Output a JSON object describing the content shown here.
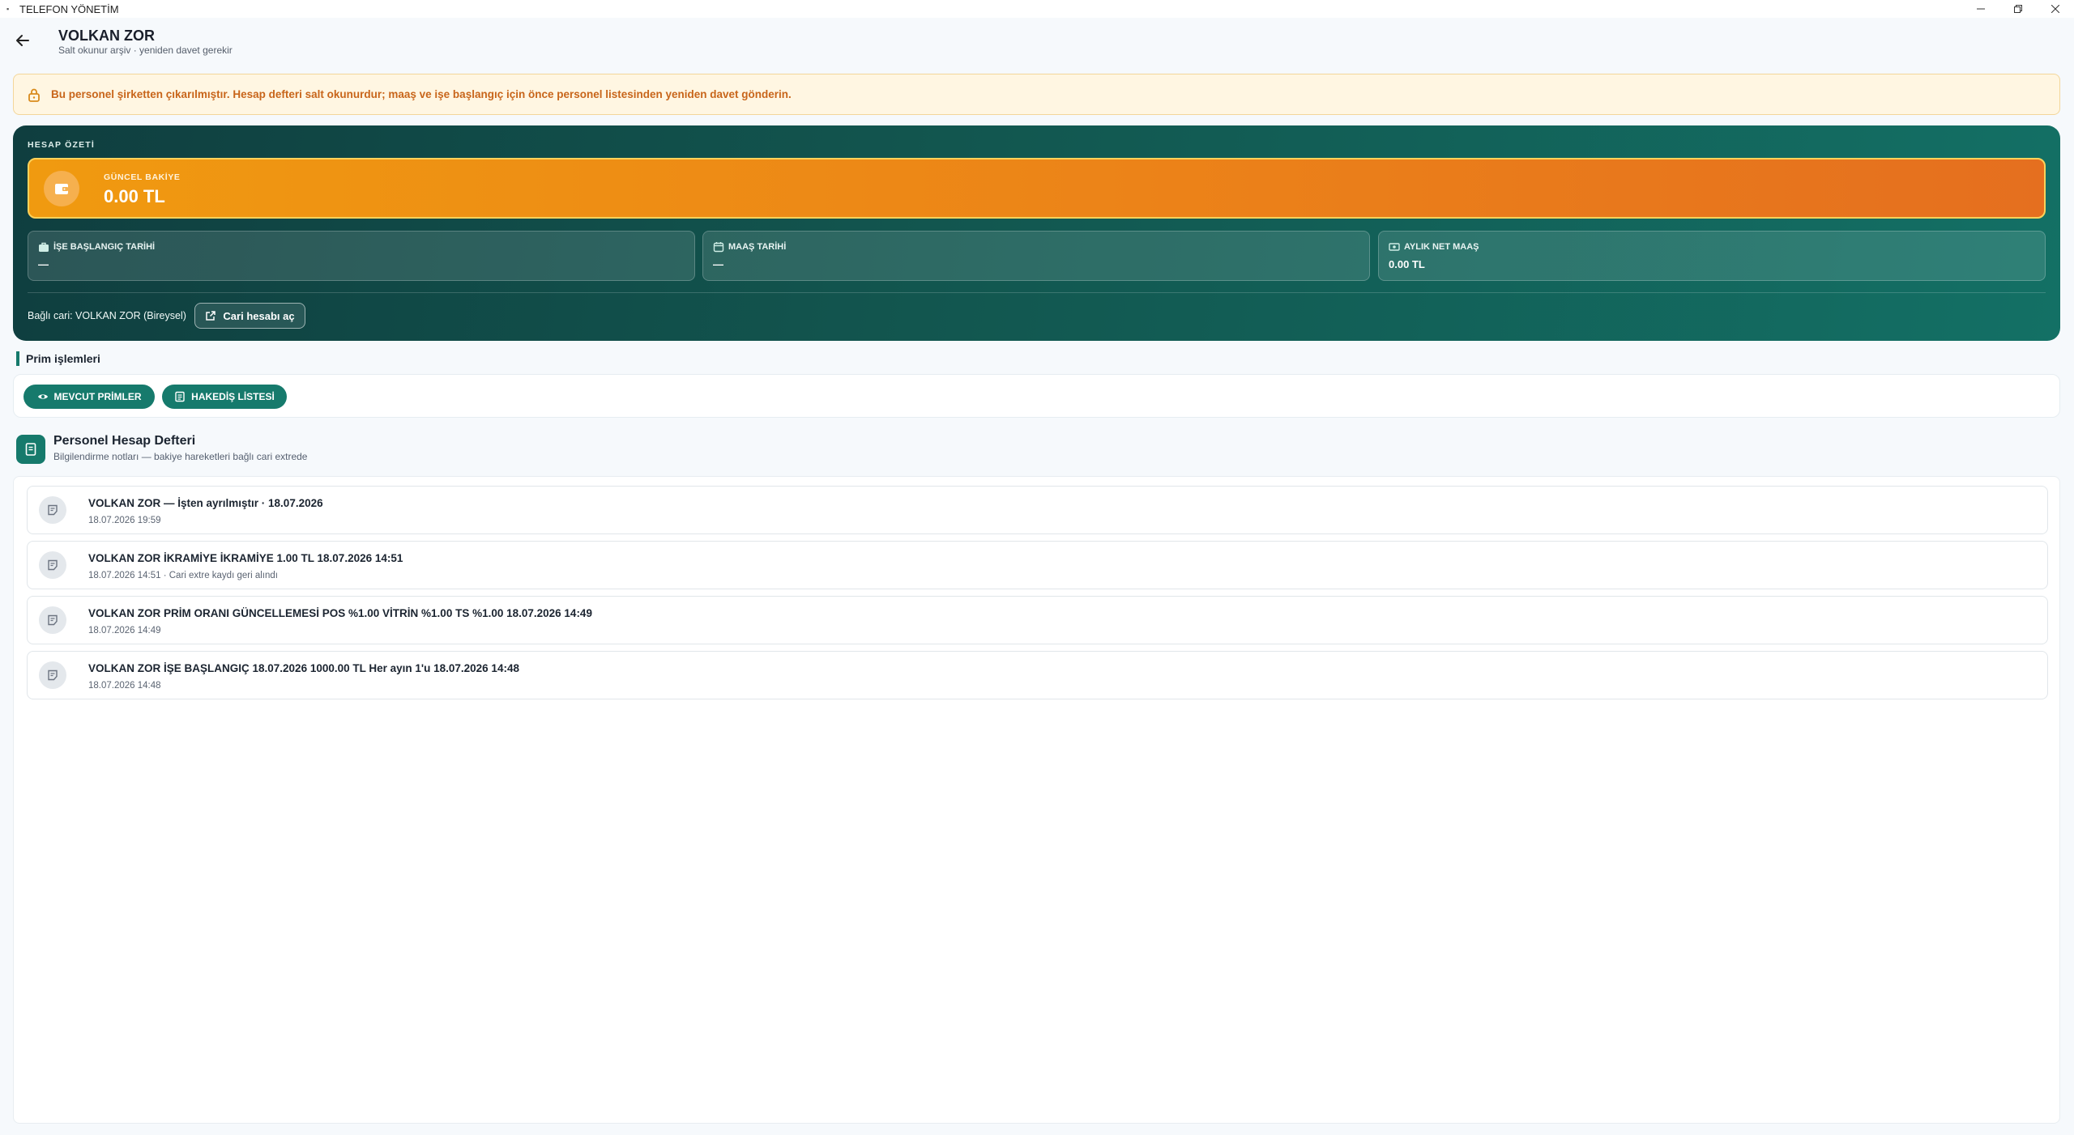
{
  "window": {
    "title": "TELEFON YÖNETİM"
  },
  "header": {
    "title": "VOLKAN ZOR",
    "subtitle": "Salt okunur arşiv · yeniden davet gerekir"
  },
  "warning": {
    "message": "Bu personel şirketten çıkarılmıştır. Hesap defteri salt okunurdur; maaş ve işe başlangıç için önce personel listesinden yeniden davet gönderin."
  },
  "summary": {
    "label": "HESAP ÖZETİ",
    "balance": {
      "label": "GÜNCEL BAKİYE",
      "value": "0.00 TL"
    },
    "stats": [
      {
        "label": "İŞE BAŞLANGIÇ TARİHİ",
        "value": "—"
      },
      {
        "label": "MAAŞ TARİHİ",
        "value": "—"
      },
      {
        "label": "AYLIK NET MAAŞ",
        "value": "0.00 TL"
      }
    ],
    "linked_label": "Bağlı cari: VOLKAN ZOR (Bireysel)",
    "open_account_button": "Cari hesabı aç"
  },
  "prim": {
    "section_title": "Prim işlemleri",
    "buttons": [
      "MEVCUT PRİMLER",
      "HAKEDİŞ LİSTESİ"
    ]
  },
  "ledger": {
    "title": "Personel Hesap Defteri",
    "subtitle": "Bilgilendirme notları — bakiye hareketleri bağlı cari extrede",
    "entries": [
      {
        "title": "VOLKAN ZOR — İşten ayrılmıştır · 18.07.2026",
        "sub": "18.07.2026 19:59"
      },
      {
        "title": "VOLKAN ZOR İKRAMİYE İKRAMİYE 1.00 TL 18.07.2026 14:51",
        "sub": "18.07.2026 14:51 · Cari extre kaydı geri alındı"
      },
      {
        "title": "VOLKAN ZOR PRİM ORANI GÜNCELLEMESİ POS %1.00 VİTRİN %1.00 TS %1.00 18.07.2026 14:49",
        "sub": "18.07.2026 14:49"
      },
      {
        "title": "VOLKAN ZOR İŞE BAŞLANGIÇ 18.07.2026 1000.00 TL Her ayın 1'u 18.07.2026 14:48",
        "sub": "18.07.2026 14:48"
      }
    ]
  },
  "colors": {
    "primary": "#167a6c",
    "accent": "#ec8318",
    "warning_text": "#c8651a"
  }
}
